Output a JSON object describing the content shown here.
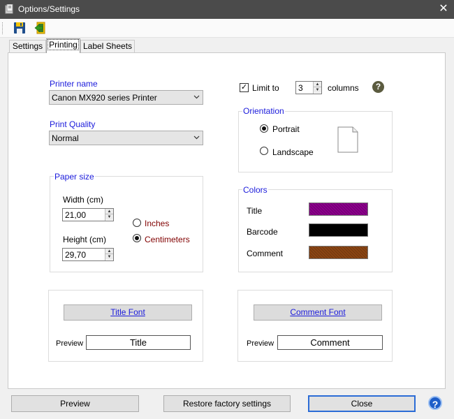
{
  "window": {
    "title": "Options/Settings",
    "close_glyph": "✕"
  },
  "toolbar": {
    "save_icon": "floppy-save-icon",
    "exit_icon": "exit-arrow-icon"
  },
  "tabs": [
    {
      "label": "Settings"
    },
    {
      "label": "Printing"
    },
    {
      "label": "Label Sheets"
    }
  ],
  "printer": {
    "name_label": "Printer name",
    "name_value": "Canon MX920 series Printer",
    "quality_label": "Print Quality",
    "quality_value": "Normal"
  },
  "limit": {
    "label": "Limit to",
    "checked": true,
    "value": "3",
    "suffix": "columns"
  },
  "orientation": {
    "title": "Orientation",
    "portrait": "Portrait",
    "landscape": "Landscape",
    "selected": "Portrait"
  },
  "paper": {
    "title": "Paper size",
    "width_label": "Width (cm)",
    "width_value": "21,00",
    "height_label": "Height (cm)",
    "height_value": "29,70",
    "inches": "Inches",
    "centimeters": "Centimeters",
    "selected_unit": "Centimeters"
  },
  "colors": {
    "title": "Colors",
    "items": [
      {
        "label": "Title",
        "color": "#8b008b"
      },
      {
        "label": "Barcode",
        "color": "#000000"
      },
      {
        "label": "Comment",
        "color": "#8b4513"
      }
    ]
  },
  "fonts": {
    "title_button_ak": "T",
    "title_button_rest": "itle Font",
    "comment_button_ak": "C",
    "comment_button_rest": "omment Font",
    "preview_label": "Preview",
    "title_preview": "Title",
    "comment_preview": "Comment"
  },
  "bottom": {
    "preview": "Preview",
    "restore": "Restore factory settings",
    "close": "Close",
    "help_glyph": "?"
  }
}
